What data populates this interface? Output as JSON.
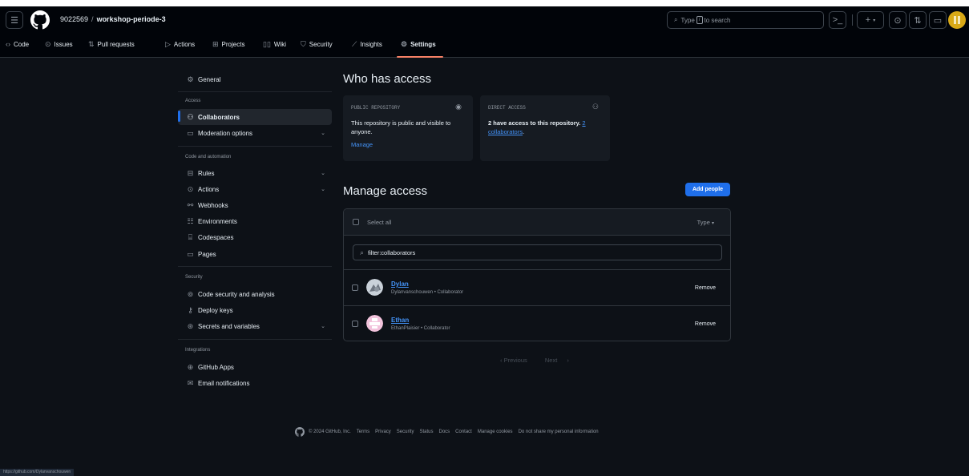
{
  "header": {
    "owner": "9022569",
    "separator": "/",
    "repo": "workshop-periode-3",
    "search": {
      "prefix": "Type",
      "key": "/",
      "suffix": "to search"
    },
    "icons": [
      "hamburger-icon",
      "github-logo-icon",
      "command-palette-icon",
      "plus-icon",
      "issues-icon",
      "pull-requests-icon",
      "inbox-icon",
      "avatar"
    ]
  },
  "tabs": [
    {
      "label": "Code",
      "icon": "code-icon"
    },
    {
      "label": "Issues",
      "icon": "issue-icon"
    },
    {
      "label": "Pull requests",
      "icon": "pull-request-icon"
    },
    {
      "label": "Actions",
      "icon": "play-icon"
    },
    {
      "label": "Projects",
      "icon": "table-icon"
    },
    {
      "label": "Wiki",
      "icon": "book-icon"
    },
    {
      "label": "Security",
      "icon": "shield-icon"
    },
    {
      "label": "Insights",
      "icon": "graph-icon"
    },
    {
      "label": "Settings",
      "icon": "gear-icon"
    }
  ],
  "sidebar": {
    "general": "General",
    "access_head": "Access",
    "collaborators": "Collaborators",
    "moderation": "Moderation options",
    "code_head": "Code and automation",
    "rules": "Rules",
    "actions": "Actions",
    "webhooks": "Webhooks",
    "environments": "Environments",
    "codespaces": "Codespaces",
    "pages": "Pages",
    "security_head": "Security",
    "code_security": "Code security and analysis",
    "deploy_keys": "Deploy keys",
    "secrets": "Secrets and variables",
    "integrations_head": "Integrations",
    "github_apps": "GitHub Apps",
    "email": "Email notifications"
  },
  "access": {
    "title": "Who has access",
    "public_label": "PUBLIC REPOSITORY",
    "public_text": "This repository is public and visible to anyone.",
    "manage_link": "Manage",
    "direct_label": "DIRECT ACCESS",
    "direct_text_bold": "2 have access to this repository.",
    "direct_text_link_1": "2",
    "direct_text_link_2": "collaborators",
    "direct_text_end": "."
  },
  "manage": {
    "title": "Manage access",
    "add_button": "Add people",
    "select_all": "Select all",
    "type_filter": "Type",
    "filter_value": "filter:collaborators",
    "collaborators": [
      {
        "name": "Dylan",
        "meta": "Dylanvanschouwen • Collaborator",
        "remove": "Remove"
      },
      {
        "name": "Ethan",
        "meta": "EthanPlaisier • Collaborator",
        "remove": "Remove"
      }
    ],
    "previous": "Previous",
    "next": "Next"
  },
  "footer": {
    "copyright": "© 2024 GitHub, Inc.",
    "links": [
      "Terms",
      "Privacy",
      "Security",
      "Status",
      "Docs",
      "Contact",
      "Manage cookies",
      "Do not share my personal information"
    ]
  },
  "statusbar": "https://github.com/Dylanvanschouwen",
  "colors": {
    "accent": "#1f6feb",
    "link": "#4493f8",
    "tab_underline": "#f78166",
    "background": "#0d1117"
  }
}
